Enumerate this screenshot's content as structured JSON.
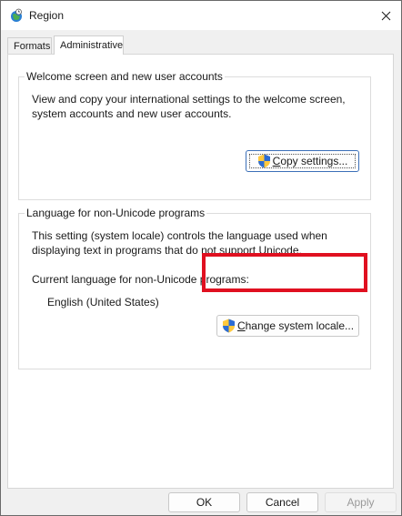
{
  "window": {
    "title": "Region",
    "close_glyph": "✕"
  },
  "tabs": [
    {
      "label": "Formats",
      "selected": false
    },
    {
      "label": "Administrative",
      "selected": true
    }
  ],
  "welcome_group": {
    "title": "Welcome screen and new user accounts",
    "description_line1": "View and copy your international settings to the welcome screen,",
    "description_line2": "system accounts and new user accounts.",
    "copy_button": {
      "accel": "C",
      "label_rest": "opy settings..."
    }
  },
  "locale_group": {
    "title": "Language for non-Unicode programs",
    "description_line1": "This setting (system locale) controls the language used when",
    "description_line2": "displaying text in programs that do not support Unicode.",
    "current_label": "Current language for non-Unicode programs:",
    "current_value": "English (United States)",
    "change_button": {
      "accel": "C",
      "label_rest": "hange system locale..."
    }
  },
  "footer": {
    "ok": "OK",
    "cancel": "Cancel",
    "apply": "Apply"
  },
  "colors": {
    "highlight": "#e01020",
    "focus_border": "#3b6fb8"
  },
  "icons": {
    "app": "region-globe-icon",
    "shield": "uac-shield-icon",
    "close": "close-icon"
  }
}
